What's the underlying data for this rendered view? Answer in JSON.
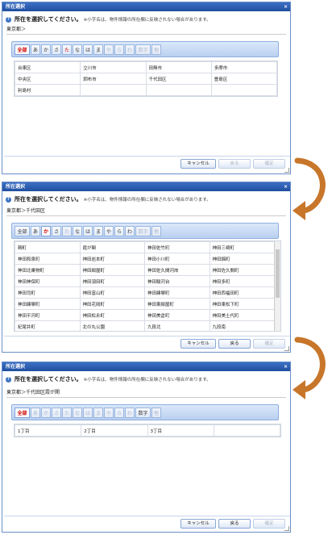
{
  "dialog_title": "所在選択",
  "close_glyph": "×",
  "hint_main": "所在を選択してください。",
  "hint_note": "※小字名は、物件情報の所在欄に反映されない場合があります。",
  "tabs": [
    "全部",
    "あ",
    "か",
    "さ",
    "た",
    "な",
    "は",
    "ま",
    "や",
    "ら",
    "わ",
    "数字",
    "他"
  ],
  "buttons": {
    "cancel": "キャンセル",
    "back": "戻る",
    "confirm": "確定"
  },
  "dialogs": [
    {
      "path": "東京都＞",
      "rows": [
        [
          "台東区",
          "立川市",
          "田無市",
          "多摩市"
        ],
        [
          "中央区",
          "調布市",
          "千代田区",
          "豊島区"
        ],
        [
          "利島村",
          "",
          "",
          ""
        ]
      ]
    },
    {
      "path": "東京都＞千代田区",
      "rows": [
        [
          "麹町",
          "霞が関",
          "神田佐竹町",
          "神田三崎町"
        ],
        [
          "神田和泉町",
          "神田岩本町",
          "神田小川町",
          "神田錦町"
        ],
        [
          "神田北乗物町",
          "神田紺屋町",
          "神田佐久間河岸",
          "神田佐久間町"
        ],
        [
          "神田神保町",
          "神田須田町",
          "神田駿河台",
          "神田多町"
        ],
        [
          "神田司町",
          "神田富山町",
          "神田練塀町",
          "神田西福田町"
        ],
        [
          "神田練塀町",
          "神田花岡町",
          "神田東紺屋町",
          "神田東松下町"
        ],
        [
          "神田平河町",
          "神田松永町",
          "神田美倉町",
          "神田美土代町"
        ],
        [
          "紀尾井町",
          "北の丸公園",
          "九段北",
          "九段南"
        ]
      ]
    },
    {
      "path": "東京都＞千代田区霞が関",
      "rows": [
        [
          "1丁目",
          "2丁目",
          "3丁目",
          ""
        ]
      ]
    }
  ],
  "colors": {
    "accent": "#1f4f9f",
    "arrow": "#c8762a",
    "selected_tab_text": "#cc0000"
  }
}
